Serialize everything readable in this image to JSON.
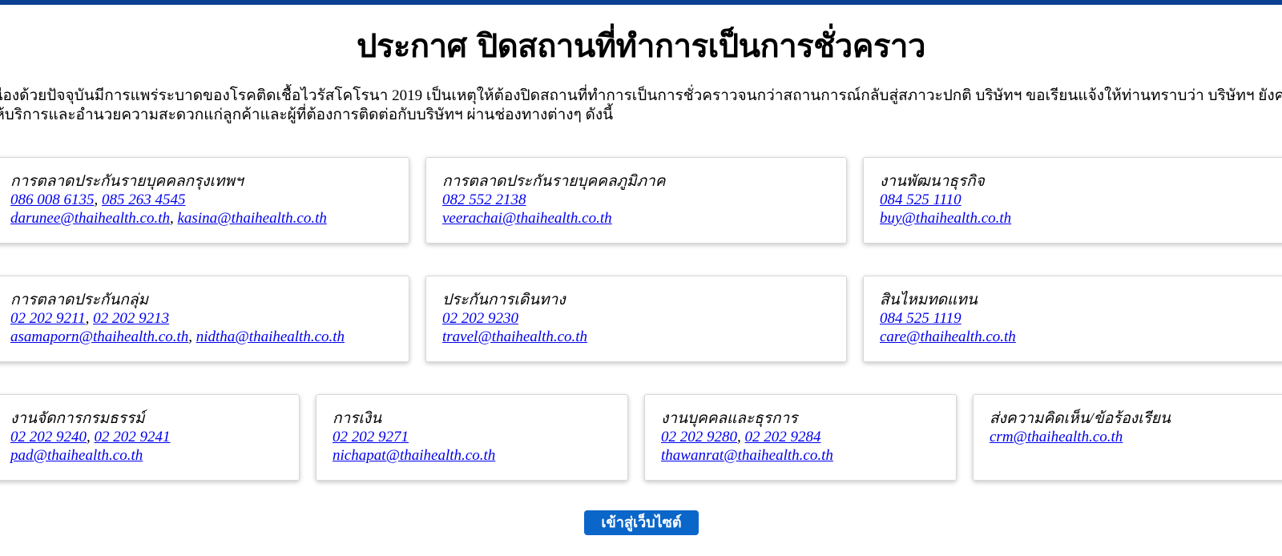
{
  "notice": {
    "title": "ประกาศ ปิดสถานที่ทำการเป็นการชั่วคราว",
    "intro_line1": "เนื่องด้วยปัจจุบันมีการแพร่ระบาดของโรคติดเชื้อไวรัสโคโรนา 2019 เป็นเหตุให้ต้องปิดสถานที่ทำการเป็นการชั่วคราวจนกว่าสถานการณ์กลับสู่สภาวะปกติ บริษัทฯ ขอเรียนแจ้งให้ท่านทราบว่า บริษัทฯ ยังคง",
    "intro_line2": "ให้บริการและอำนวยความสะดวกแก่ลูกค้าและผู้ที่ต้องการติดต่อกับบริษัทฯ ผ่านช่องทางต่างๆ ดังนี้"
  },
  "contacts": [
    {
      "heading": "การตลาดประกันรายบุคคลกรุงเทพฯ",
      "phones": [
        "086 008 6135",
        "085 263 4545"
      ],
      "emails": [
        "darunee@thaihealth.co.th",
        "kasina@thaihealth.co.th"
      ]
    },
    {
      "heading": "การตลาดประกันรายบุคคลภูมิภาค",
      "phones": [
        "082 552 2138"
      ],
      "emails": [
        "veerachai@thaihealth.co.th"
      ]
    },
    {
      "heading": "งานพัฒนาธุรกิจ",
      "phones": [
        "084 525 1110"
      ],
      "emails": [
        "buy@thaihealth.co.th"
      ]
    },
    {
      "heading": "การตลาดประกันกลุ่ม",
      "phones": [
        "02 202 9211",
        "02 202 9213"
      ],
      "emails": [
        "asamaporn@thaihealth.co.th",
        "nidtha@thaihealth.co.th"
      ]
    },
    {
      "heading": "ประกันการเดินทาง",
      "phones": [
        "02 202 9230"
      ],
      "emails": [
        "travel@thaihealth.co.th"
      ]
    },
    {
      "heading": "สินไหมทดแทน",
      "phones": [
        "084 525 1119"
      ],
      "emails": [
        "care@thaihealth.co.th"
      ]
    },
    {
      "heading": "งานจัดการกรมธรรม์",
      "phones": [
        "02 202 9240",
        "02 202 9241"
      ],
      "emails": [
        "pad@thaihealth.co.th"
      ]
    },
    {
      "heading": "การเงิน",
      "phones": [
        "02 202 9271"
      ],
      "emails": [
        "nichapat@thaihealth.co.th"
      ]
    },
    {
      "heading": "งานบุคคลและธุรการ",
      "phones": [
        "02 202 9280",
        "02 202 9284"
      ],
      "emails": [
        "thawanrat@thaihealth.co.th"
      ]
    },
    {
      "heading": "ส่งความคิดเห็น/ข้อร้องเรียน",
      "phones": [],
      "emails": [
        "crm@thaihealth.co.th"
      ]
    }
  ],
  "actions": {
    "enter_site_label": "เข้าสู่เว็บไซต์"
  },
  "colors": {
    "top_bar": "#0b3f91",
    "button_bg": "#0a66c9",
    "link": "#0000ee"
  }
}
